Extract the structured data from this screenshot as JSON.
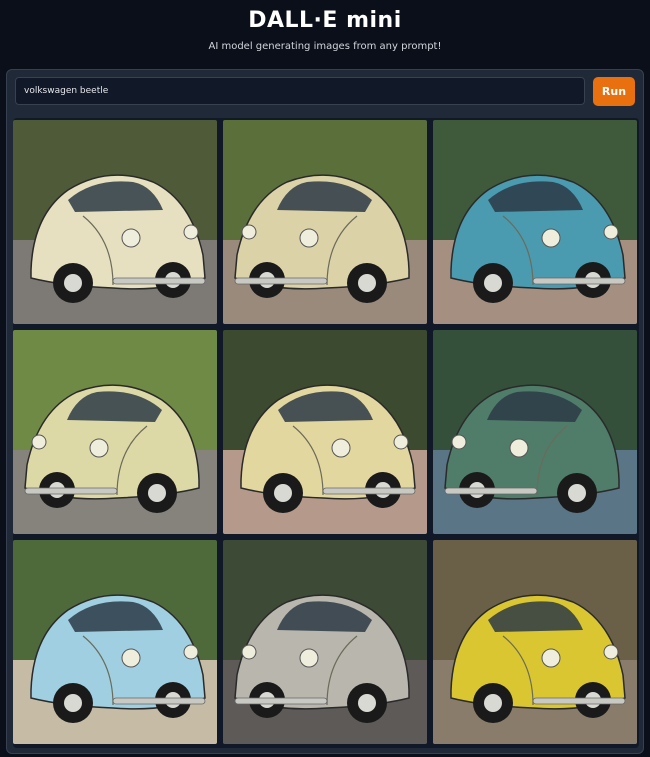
{
  "header": {
    "title": "DALL·E mini",
    "subtitle": "AI model generating images from any prompt!"
  },
  "prompt": {
    "value": "volkswagen beetle"
  },
  "run_button": {
    "label": "Run"
  },
  "accent_color": "#e8700f",
  "gallery": {
    "images": [
      {
        "subject": "cream volkswagen beetle",
        "body_color": "#e6e0c0",
        "bg_color": "#4f5a38",
        "ground_color": "#7d7a75"
      },
      {
        "subject": "cream volkswagen beetle",
        "body_color": "#dcd2a8",
        "bg_color": "#5b6f3a",
        "ground_color": "#9a8a7c"
      },
      {
        "subject": "blue volkswagen beetle",
        "body_color": "#4a9bb0",
        "bg_color": "#3f5a3a",
        "ground_color": "#a58f80"
      },
      {
        "subject": "cream volkswagen beetle",
        "body_color": "#ddd9a6",
        "bg_color": "#6f8a44",
        "ground_color": "#85837c"
      },
      {
        "subject": "cream volkswagen beetle",
        "body_color": "#e3d7a0",
        "bg_color": "#3c4a30",
        "ground_color": "#b59a8c"
      },
      {
        "subject": "teal volkswagen beetle",
        "body_color": "#4f7d6a",
        "bg_color": "#34503a",
        "ground_color": "#5a7586"
      },
      {
        "subject": "light blue volkswagen beetle",
        "body_color": "#9fcfe0",
        "bg_color": "#4f6a3a",
        "ground_color": "#c6bca6"
      },
      {
        "subject": "grey volkswagen beetle",
        "body_color": "#b8b6ad",
        "bg_color": "#3d4a35",
        "ground_color": "#5e5a58"
      },
      {
        "subject": "yellow volkswagen beetle",
        "body_color": "#d9c630",
        "bg_color": "#6a6048",
        "ground_color": "#8a7c6a"
      }
    ]
  }
}
